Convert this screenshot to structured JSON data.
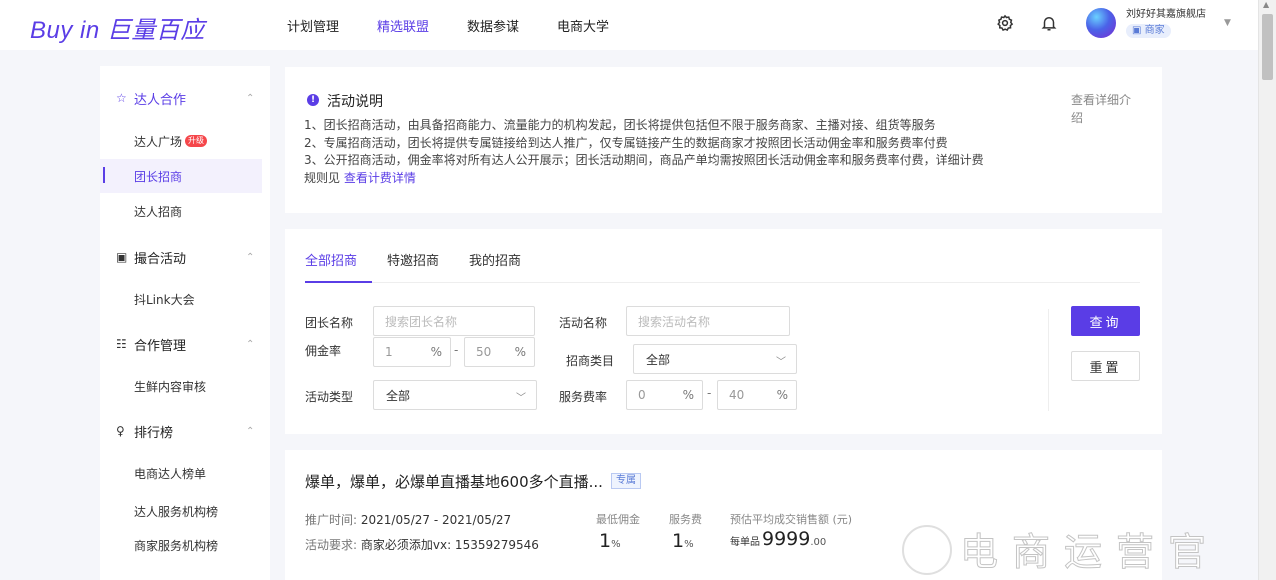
{
  "brand": {
    "logo_en": "Buy in",
    "logo_cn": "巨量百应"
  },
  "nav": {
    "items": [
      "计划管理",
      "精选联盟",
      "数据参谋",
      "电商大学"
    ],
    "active_index": 1
  },
  "user": {
    "shop_name": "刘好好其嘉旗舰店",
    "role": "商家"
  },
  "icons": {
    "settings": "gear-icon",
    "bell": "bell-icon",
    "caret": "caret-down-icon"
  },
  "colors": {
    "accent": "#5a3de6",
    "badge": "#f5464a"
  },
  "sidebar": {
    "sections": [
      {
        "title": "达人合作",
        "icon": "star-icon",
        "items": [
          {
            "label": "达人广场",
            "badge": "升级"
          },
          {
            "label": "团长招商",
            "active": true
          },
          {
            "label": "达人招商"
          }
        ]
      },
      {
        "title": "撮合活动",
        "icon": "grid-icon",
        "items": [
          {
            "label": "抖Link大会"
          }
        ]
      },
      {
        "title": "合作管理",
        "icon": "document-icon",
        "items": [
          {
            "label": "生鲜内容审核"
          }
        ]
      },
      {
        "title": "排行榜",
        "icon": "trophy-icon",
        "items": [
          {
            "label": "电商达人榜单"
          },
          {
            "label": "达人服务机构榜"
          },
          {
            "label": "商家服务机构榜"
          }
        ]
      }
    ]
  },
  "notice": {
    "title": "活动说明",
    "line1": "1、团长招商活动，由具备招商能力、流量能力的机构发起，团长将提供包括但不限于服务商家、主播对接、组货等服务",
    "line2": "2、专属招商活动，团长将提供专属链接给到达人推广，仅专属链接产生的数据商家才按照团长活动佣金率和服务费率付费",
    "line3": "3、公开招商活动，佣金率将对所有达人公开展示；团长活动期间，商品产单均需按照团长活动佣金率和服务费率付费，详细计费",
    "line4_prefix": "规则见",
    "line4_link": "查看计费详情",
    "more": "查看详细介绍"
  },
  "filter": {
    "tabs": [
      "全部招商",
      "特邀招商",
      "我的招商"
    ],
    "active_tab": 0,
    "leader_label": "团长名称",
    "leader_placeholder": "搜索团长名称",
    "activity_label": "活动名称",
    "activity_placeholder": "搜索活动名称",
    "commission_label": "佣金率",
    "commission_min": "1",
    "commission_max": "50",
    "percent": "%",
    "dash": "-",
    "category_label": "招商类目",
    "category_value": "全部",
    "type_label": "活动类型",
    "type_value": "全部",
    "service_label": "服务费率",
    "service_min": "0",
    "service_max": "40",
    "query_button": "查询",
    "reset_button": "重置"
  },
  "activity": {
    "title": "爆单，爆单，必爆单直播基地600多个直播...",
    "tag": "专属",
    "time_label": "推广时间:",
    "time_value": "2021/05/27 - 2021/05/27",
    "req_label": "活动要求:",
    "req_value": "商家必须添加vx: 15359279546",
    "min_commission_label": "最低佣金",
    "min_commission_value": "1",
    "service_fee_label": "服务费",
    "service_fee_value": "1",
    "unit": "%",
    "avg_sales_label": "预估平均成交销售额 (元)",
    "avg_sales_prefix": "每单品",
    "avg_sales_int": "9999",
    "avg_sales_dec": ".00"
  },
  "watermark": {
    "text": "电商运营官"
  }
}
